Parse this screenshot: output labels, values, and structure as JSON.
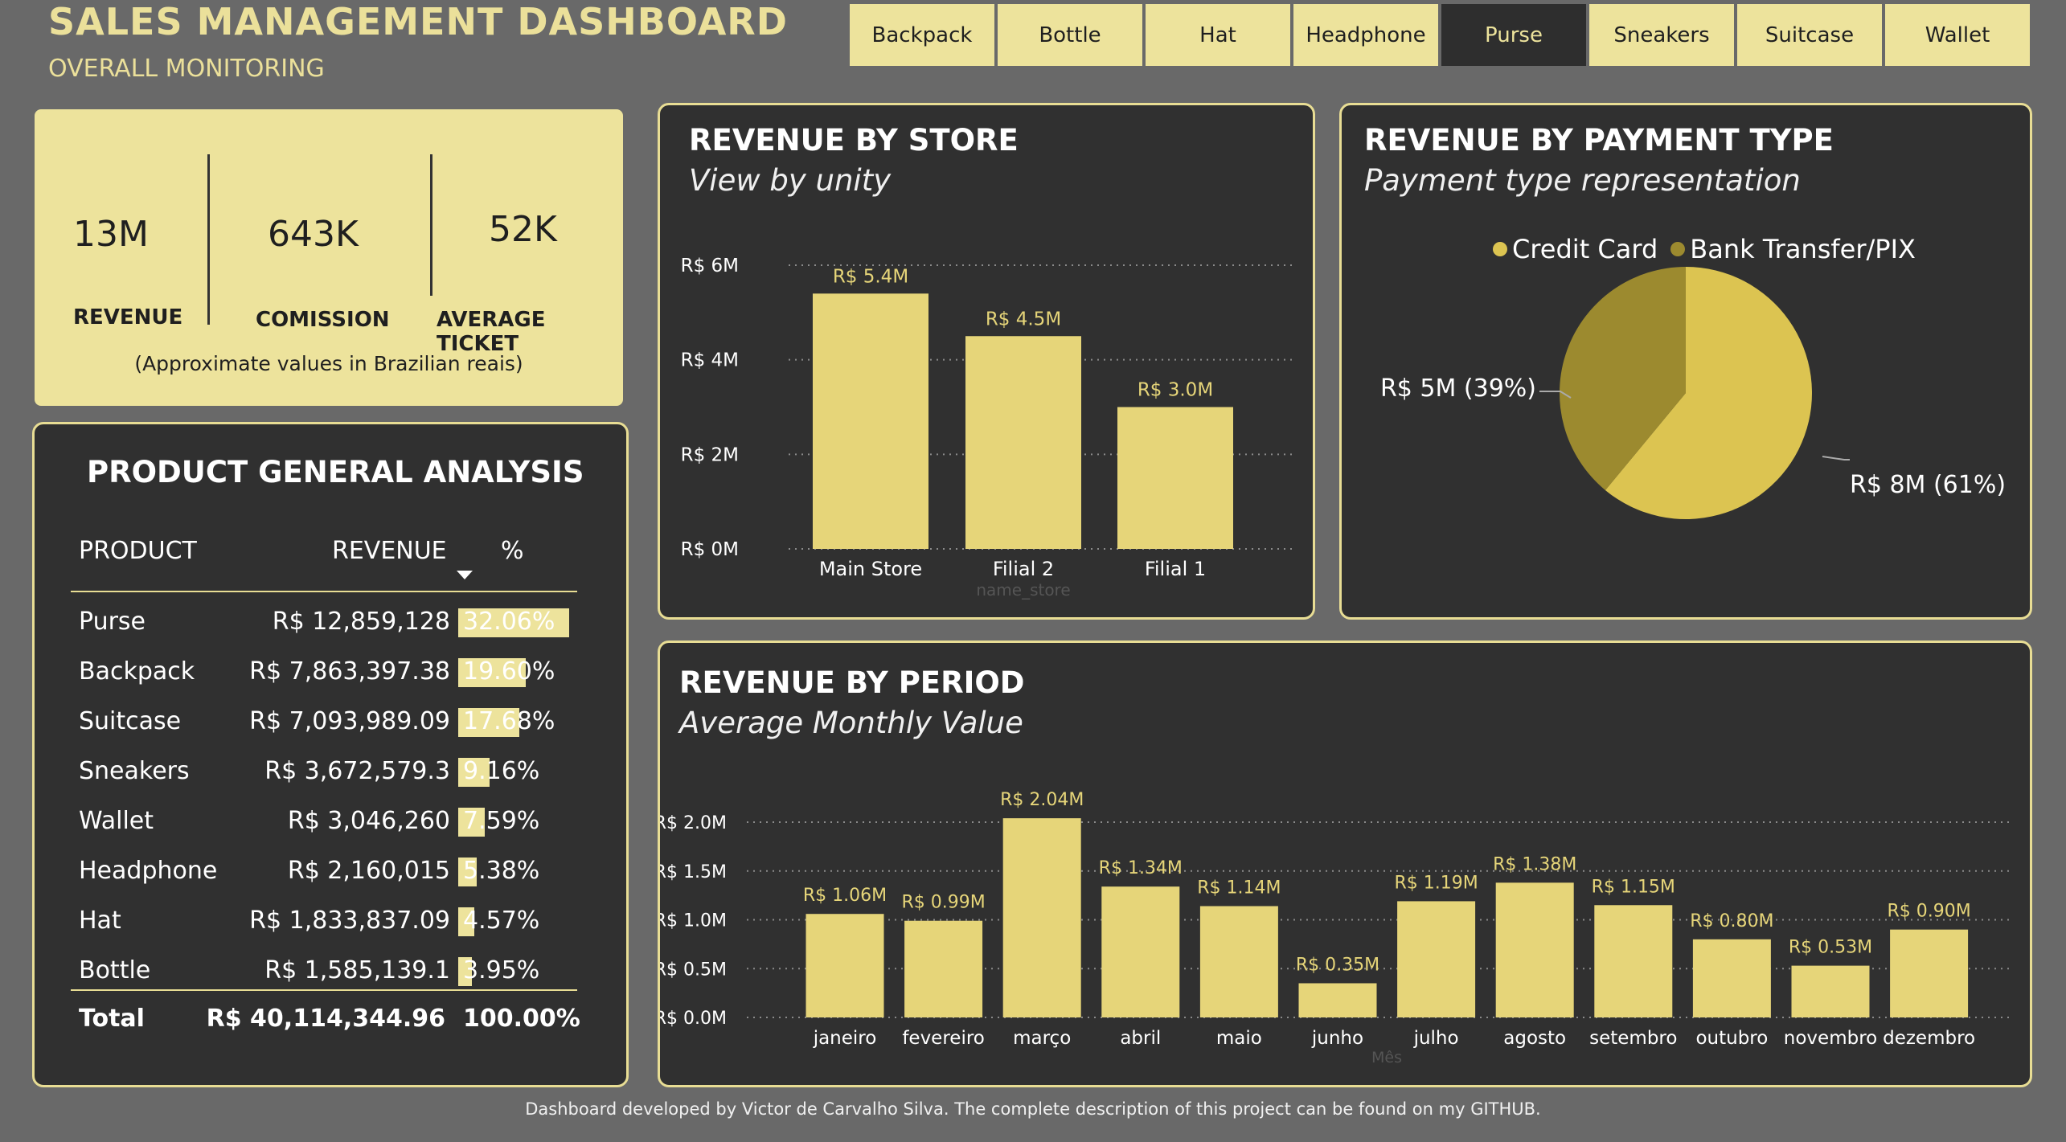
{
  "header": {
    "title": "SALES MANAGEMENT DASHBOARD",
    "subtitle": "OVERALL MONITORING",
    "tabs": [
      {
        "label": "Backpack",
        "active": false
      },
      {
        "label": "Bottle",
        "active": false
      },
      {
        "label": "Hat",
        "active": false
      },
      {
        "label": "Headphone",
        "active": false
      },
      {
        "label": "Purse",
        "active": true
      },
      {
        "label": "Sneakers",
        "active": false
      },
      {
        "label": "Suitcase",
        "active": false
      },
      {
        "label": "Wallet",
        "active": false
      }
    ]
  },
  "kpi": {
    "revenue_value": "13M",
    "revenue_label": "REVENUE",
    "commission_value": "643K",
    "commission_label": "COMISSION",
    "ticket_value": "52K",
    "ticket_label": "AVERAGE TICKET",
    "note": "(Approximate values in Brazilian reais)"
  },
  "product_table": {
    "title": "PRODUCT GENERAL ANALYSIS",
    "columns": [
      "PRODUCT",
      "REVENUE",
      "%"
    ],
    "rows": [
      {
        "product": "Purse",
        "revenue": "R$ 12,859,128",
        "pct": "32.06%",
        "pct_value": 32.06
      },
      {
        "product": "Backpack",
        "revenue": "R$ 7,863,397.38",
        "pct": "19.60%",
        "pct_value": 19.6
      },
      {
        "product": "Suitcase",
        "revenue": "R$ 7,093,989.09",
        "pct": "17.68%",
        "pct_value": 17.68
      },
      {
        "product": "Sneakers",
        "revenue": "R$ 3,672,579.3",
        "pct": "9.16%",
        "pct_value": 9.16
      },
      {
        "product": "Wallet",
        "revenue": "R$ 3,046,260",
        "pct": "7.59%",
        "pct_value": 7.59
      },
      {
        "product": "Headphone",
        "revenue": "R$ 2,160,015",
        "pct": "5.38%",
        "pct_value": 5.38
      },
      {
        "product": "Hat",
        "revenue": "R$ 1,833,837.09",
        "pct": "4.57%",
        "pct_value": 4.57
      },
      {
        "product": "Bottle",
        "revenue": "R$ 1,585,139.1",
        "pct": "3.95%",
        "pct_value": 3.95
      }
    ],
    "total": {
      "label": "Total",
      "revenue": "R$ 40,114,344.96",
      "pct": "100.00%"
    }
  },
  "chart_data": [
    {
      "type": "bar",
      "title": "REVENUE BY STORE",
      "subtitle": "View by unity",
      "xlabel": "name_store",
      "categories": [
        "Main Store",
        "Filial 2",
        "Filial 1"
      ],
      "values": [
        5.4,
        4.5,
        3.0
      ],
      "data_labels": [
        "R$ 5.4M",
        "R$ 4.5M",
        "R$ 3.0M"
      ],
      "yticks": [
        "R$ 0M",
        "R$ 2M",
        "R$ 4M",
        "R$ 6M"
      ],
      "ylim": [
        0,
        6
      ],
      "bar_color": "#e6d579"
    },
    {
      "type": "pie",
      "title": "REVENUE BY PAYMENT TYPE",
      "subtitle": "Payment type representation",
      "legend": [
        {
          "name": "Credit Card",
          "color": "#dcc451"
        },
        {
          "name": "Bank Transfer/PIX",
          "color": "#9c8a2f"
        }
      ],
      "values": [
        61,
        39
      ],
      "data_labels": [
        "R$ 8M (61%)",
        "R$ 5M (39%)"
      ]
    },
    {
      "type": "bar",
      "title": "REVENUE BY PERIOD",
      "subtitle": "Average Monthly Value",
      "xlabel": "Mês",
      "categories": [
        "janeiro",
        "fevereiro",
        "março",
        "abril",
        "maio",
        "junho",
        "julho",
        "agosto",
        "setembro",
        "outubro",
        "novembro",
        "dezembro"
      ],
      "values": [
        1.06,
        0.99,
        2.04,
        1.34,
        1.14,
        0.35,
        1.19,
        1.38,
        1.15,
        0.8,
        0.53,
        0.9
      ],
      "data_labels": [
        "R$ 1.06M",
        "R$ 0.99M",
        "R$ 2.04M",
        "R$ 1.34M",
        "R$ 1.14M",
        "R$ 0.35M",
        "R$ 1.19M",
        "R$ 1.38M",
        "R$ 1.15M",
        "R$ 0.80M",
        "R$ 0.53M",
        "R$ 0.90M"
      ],
      "yticks": [
        "R$ 0.0M",
        "R$ 0.5M",
        "R$ 1.0M",
        "R$ 1.5M",
        "R$ 2.0M"
      ],
      "ylim": [
        0,
        2.0
      ],
      "bar_color": "#e6d579"
    }
  ],
  "footer": "Dashboard developed by Victor de Carvalho Silva. The complete description of this project can be found on my GITHUB."
}
